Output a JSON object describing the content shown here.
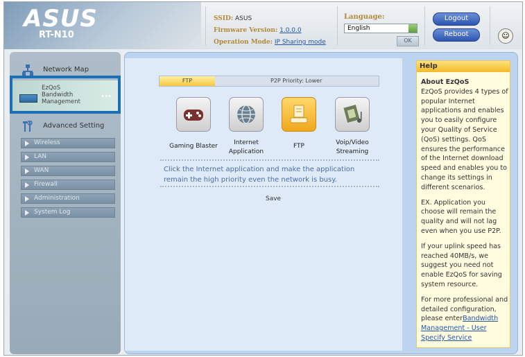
{
  "header": {
    "brand": "ASUS",
    "model": "RT-N10",
    "ssid_label": "SSID:",
    "ssid_value": "ASUS",
    "firmware_label": "Firmware Version:",
    "firmware_value": "1.0.0.0",
    "opmode_label": "Operation Mode:",
    "opmode_value": "IP Sharing mode",
    "language_label": "Language:",
    "language_value": "English",
    "ok_label": "OK",
    "logout_label": "Logout",
    "reboot_label": "Reboot"
  },
  "sidebar": {
    "network_map": "Network Map",
    "ezqos": [
      "EzQoS",
      "Bandwidth",
      "Management"
    ],
    "advanced_setting": "Advanced Setting",
    "sub_items": [
      "Wireless",
      "LAN",
      "WAN",
      "Firewall",
      "Administration",
      "System Log"
    ]
  },
  "main": {
    "tab_active": "FTP",
    "priority_text": "P2P Priority: Lower",
    "apps": [
      {
        "label": "Gaming Blaster",
        "icon": "gamepad-icon"
      },
      {
        "label": "Internet Application",
        "icon": "globe-icon"
      },
      {
        "label": "FTP",
        "icon": "document-icon"
      },
      {
        "label": "Voip/Video Streaming",
        "icon": "film-music-icon"
      }
    ],
    "description": "Click the Internet application and make the application remain the high priority even the network is busy.",
    "save_label": "Save"
  },
  "help": {
    "title": "Help",
    "heading": "About EzQoS",
    "p1": "EzQoS provides 4 types of popular Internet applications and enables you to easily configure your Quality of Service (QoS) settings. QoS ensures the performance of the Internet download speed and enables you to change its settings in different scenarios.",
    "p2": "EX. Application you choose will remain the quality and will not lag even when you use P2P.",
    "p3": "If your uplink speed has reached 40MB/s, we suggest you need not enable EzQoS for saving system resource.",
    "p4_text": "For more professional and detailed configuration, please enter",
    "p4_link": "Bandwidth Management - User Specify Service"
  },
  "colors": {
    "accent_blue": "#1a6fb6",
    "link": "#2255aa",
    "ftp_active": "#f6c844"
  }
}
